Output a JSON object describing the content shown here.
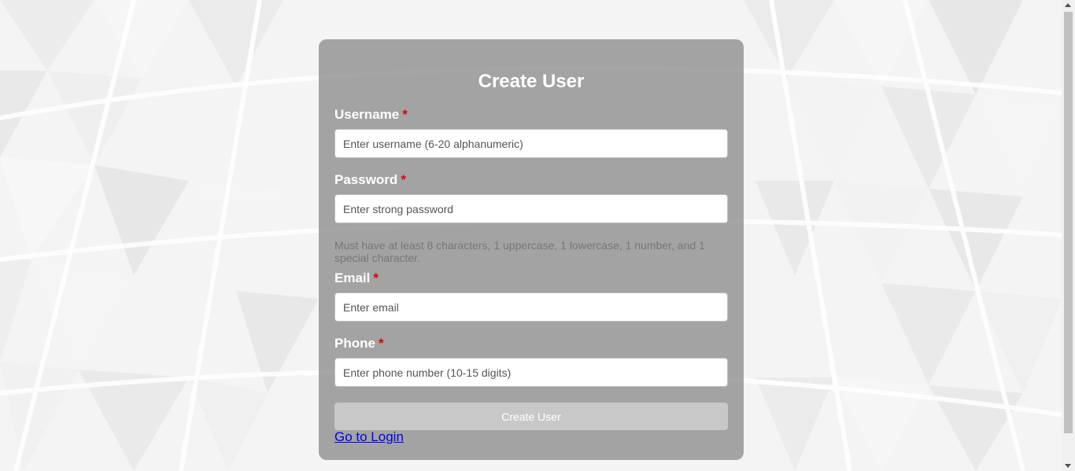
{
  "form": {
    "title": "Create User",
    "required_marker": "*",
    "username": {
      "label": "Username",
      "placeholder": "Enter username (6-20 alphanumeric)",
      "value": ""
    },
    "password": {
      "label": "Password",
      "placeholder": "Enter strong password",
      "value": "",
      "hint": "Must have at least 8 characters, 1 uppercase, 1 lowercase, 1 number, and 1 special character."
    },
    "email": {
      "label": "Email",
      "placeholder": "Enter email",
      "value": ""
    },
    "phone": {
      "label": "Phone",
      "placeholder": "Enter phone number (10-15 digits)",
      "value": ""
    },
    "submit_label": "Create User",
    "login_link_label": "Go to Login"
  },
  "colors": {
    "card_background": "#8c8c8c",
    "required_marker": "#e00000",
    "submit_background": "#c8c8c8",
    "link": "#0000ee"
  }
}
